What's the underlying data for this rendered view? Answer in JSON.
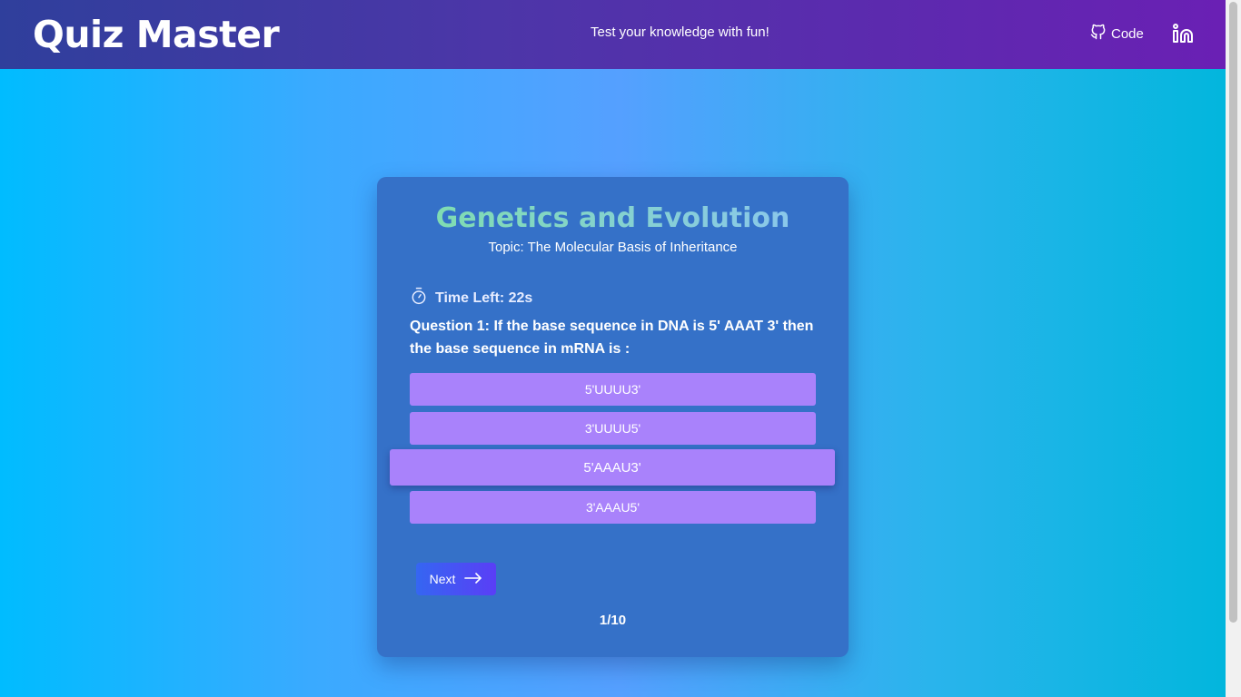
{
  "header": {
    "brand": "Quiz Master",
    "tagline": "Test your knowledge with fun!",
    "code_label": "Code",
    "code_icon": "github-icon",
    "linkedin_icon": "linkedin-icon"
  },
  "quiz": {
    "subject": "Genetics and Evolution",
    "topic": "Topic: The Molecular Basis of Inheritance",
    "timer_label": "Time Left: 22s",
    "timer_icon": "stopwatch-icon",
    "question": "Question 1: If the base sequence in DNA is 5' AAAT 3' then the base sequence in mRNA is :",
    "options": [
      "5'UUUU3'",
      "3'UUUU5'",
      "5'AAAU3'",
      "3'AAAU5'"
    ],
    "hovered_option_index": 2,
    "next_label": "Next",
    "progress": "1/10"
  },
  "colors": {
    "header_start": "#2f3f9c",
    "header_end": "#6a20b4",
    "card": "#3571c8",
    "option": "#a982fb",
    "next_button": "#3566f2"
  }
}
